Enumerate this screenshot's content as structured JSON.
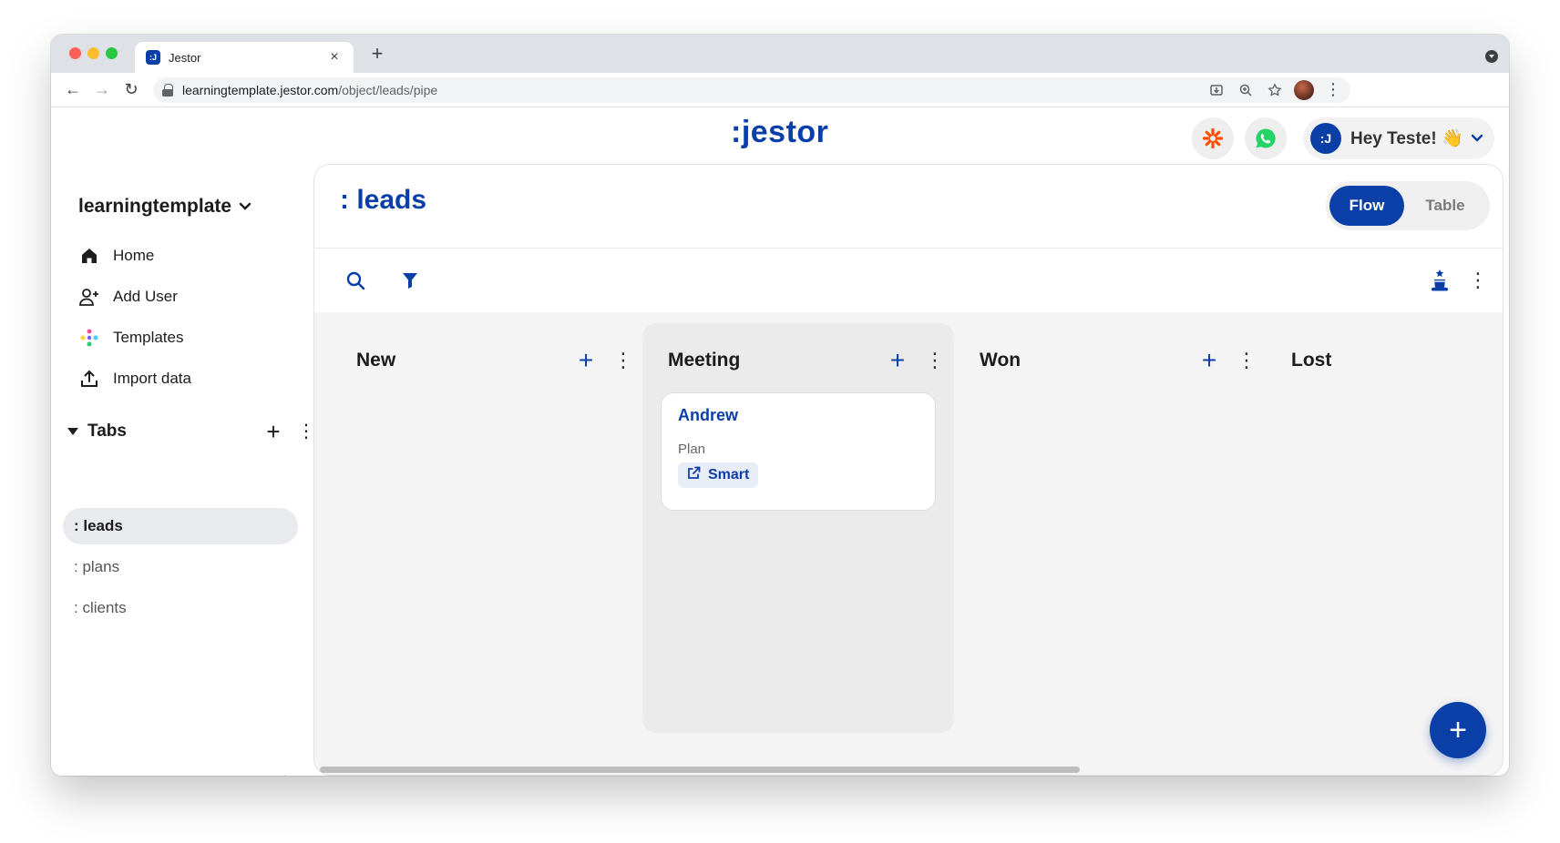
{
  "browser": {
    "tab_title": "Jestor",
    "tab_favicon": ":J",
    "url_host": "learningtemplate.jestor.com",
    "url_path": "/object/leads/pipe"
  },
  "header": {
    "logo": ":jestor",
    "user_avatar": ":J",
    "greeting": "Hey Teste! 👋"
  },
  "sidebar": {
    "workspace": "learningtemplate",
    "nav": [
      {
        "label": "Home",
        "icon": "home-icon"
      },
      {
        "label": "Add User",
        "icon": "add-user-icon"
      },
      {
        "label": "Templates",
        "icon": "templates-icon"
      },
      {
        "label": "Import data",
        "icon": "upload-icon"
      }
    ],
    "tabs_title": "Tabs",
    "tabs": [
      {
        "label": ": leads",
        "active": true
      },
      {
        "label": ": plans",
        "active": false
      },
      {
        "label": ": clients",
        "active": false
      }
    ]
  },
  "main": {
    "title": ": leads",
    "views": {
      "flow": "Flow",
      "table": "Table",
      "active": "Flow"
    }
  },
  "board": {
    "columns": [
      {
        "title": "New",
        "highlight": false
      },
      {
        "title": "Meeting",
        "highlight": true
      },
      {
        "title": "Won",
        "highlight": false
      },
      {
        "title": "Lost",
        "highlight": false
      }
    ],
    "cards": [
      {
        "column": "Meeting",
        "title": "Andrew",
        "field_label": "Plan",
        "field_value": "Smart"
      }
    ]
  },
  "colors": {
    "brand": "#0a3fa8",
    "zapier": "#ff4f00",
    "whatsapp": "#25d366"
  }
}
